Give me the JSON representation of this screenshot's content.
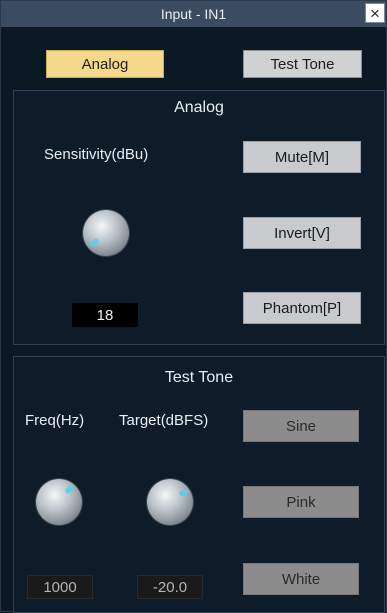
{
  "window": {
    "title": "Input - IN1",
    "close_label": "×"
  },
  "mode_tabs": {
    "analog_label": "Analog",
    "test_tone_label": "Test Tone"
  },
  "analog": {
    "title": "Analog",
    "sensitivity_label": "Sensitivity(dBu)",
    "sensitivity_value": "18",
    "mute_label": "Mute[M]",
    "invert_label": "Invert[V]",
    "phantom_label": "Phantom[P]"
  },
  "test_tone": {
    "title": "Test Tone",
    "freq_label": "Freq(Hz)",
    "target_label": "Target(dBFS)",
    "freq_value": "1000",
    "target_value": "-20.0",
    "sine_label": "Sine",
    "pink_label": "Pink",
    "white_label": "White"
  },
  "colors": {
    "accent": "#f4d98a",
    "knob_indicator": "#5fd0e6",
    "background": "#0c1925"
  }
}
